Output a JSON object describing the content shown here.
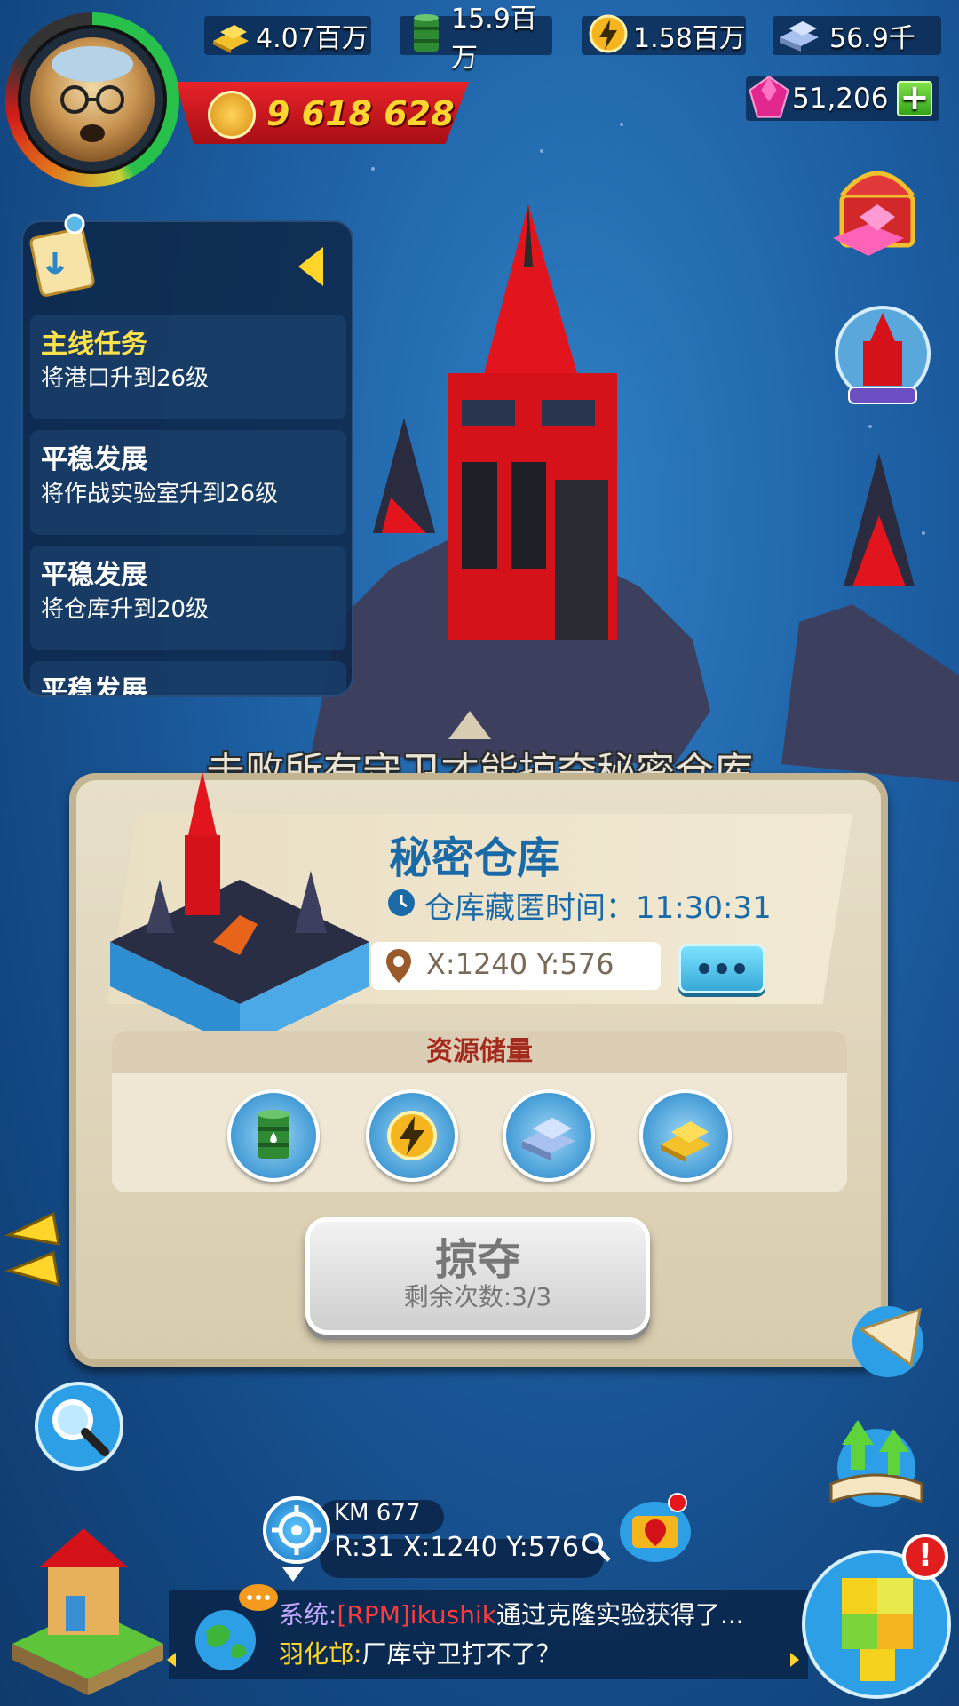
{
  "resources": {
    "gold": {
      "icon": "gold-bars-icon",
      "value": "4.07百万"
    },
    "oil": {
      "icon": "oil-barrel-icon",
      "value": "15.9百万"
    },
    "electricity": {
      "icon": "lightning-icon",
      "value": "1.58百万"
    },
    "steel": {
      "icon": "steel-ingot-icon",
      "value": "56.9千"
    },
    "gems": {
      "icon": "gem-icon",
      "value": "51,206",
      "add_label": "+"
    }
  },
  "player": {
    "power_value": "9 618 628"
  },
  "quests": {
    "items": [
      {
        "title": "主线任务",
        "desc": "将港口升到26级",
        "main": true
      },
      {
        "title": "平稳发展",
        "desc": "将作战实验室升到26级",
        "main": false
      },
      {
        "title": "平稳发展",
        "desc": "将仓库升到20级",
        "main": false
      },
      {
        "title": "平稳发展",
        "desc": "",
        "main": false
      }
    ]
  },
  "hint_text": "击败所有守卫才能掠夺秘密仓库",
  "popup": {
    "title": "秘密仓库",
    "time_label": "仓库藏匿时间：11:30:31",
    "coords": "X:1240 Y:576",
    "resources_header": "资源储量",
    "resource_icons": [
      "oil-barrel-icon",
      "lightning-icon",
      "steel-ingot-icon",
      "gold-bars-icon"
    ],
    "plunder_label": "掠夺",
    "plunder_remaining": "剩余次数:3/3"
  },
  "map": {
    "km_label": "KM 677",
    "position_label": "R:31 X:1240 Y:576"
  },
  "chat": {
    "line1": {
      "sender": "系统:",
      "tag": "[RPM]ikushik",
      "message": "通过克隆实验获得了..."
    },
    "line2": {
      "sender": "羽化邙:",
      "message": "厂库守卫打不了？"
    }
  },
  "notifications": {
    "puzzle_alert": "!"
  },
  "colors": {
    "ocean": "#1d5fa3",
    "popup_bg": "#e8dfc9",
    "title_blue": "#1b6aa8",
    "header_red": "#a32a1c",
    "power_gold": "#ffd52e"
  }
}
